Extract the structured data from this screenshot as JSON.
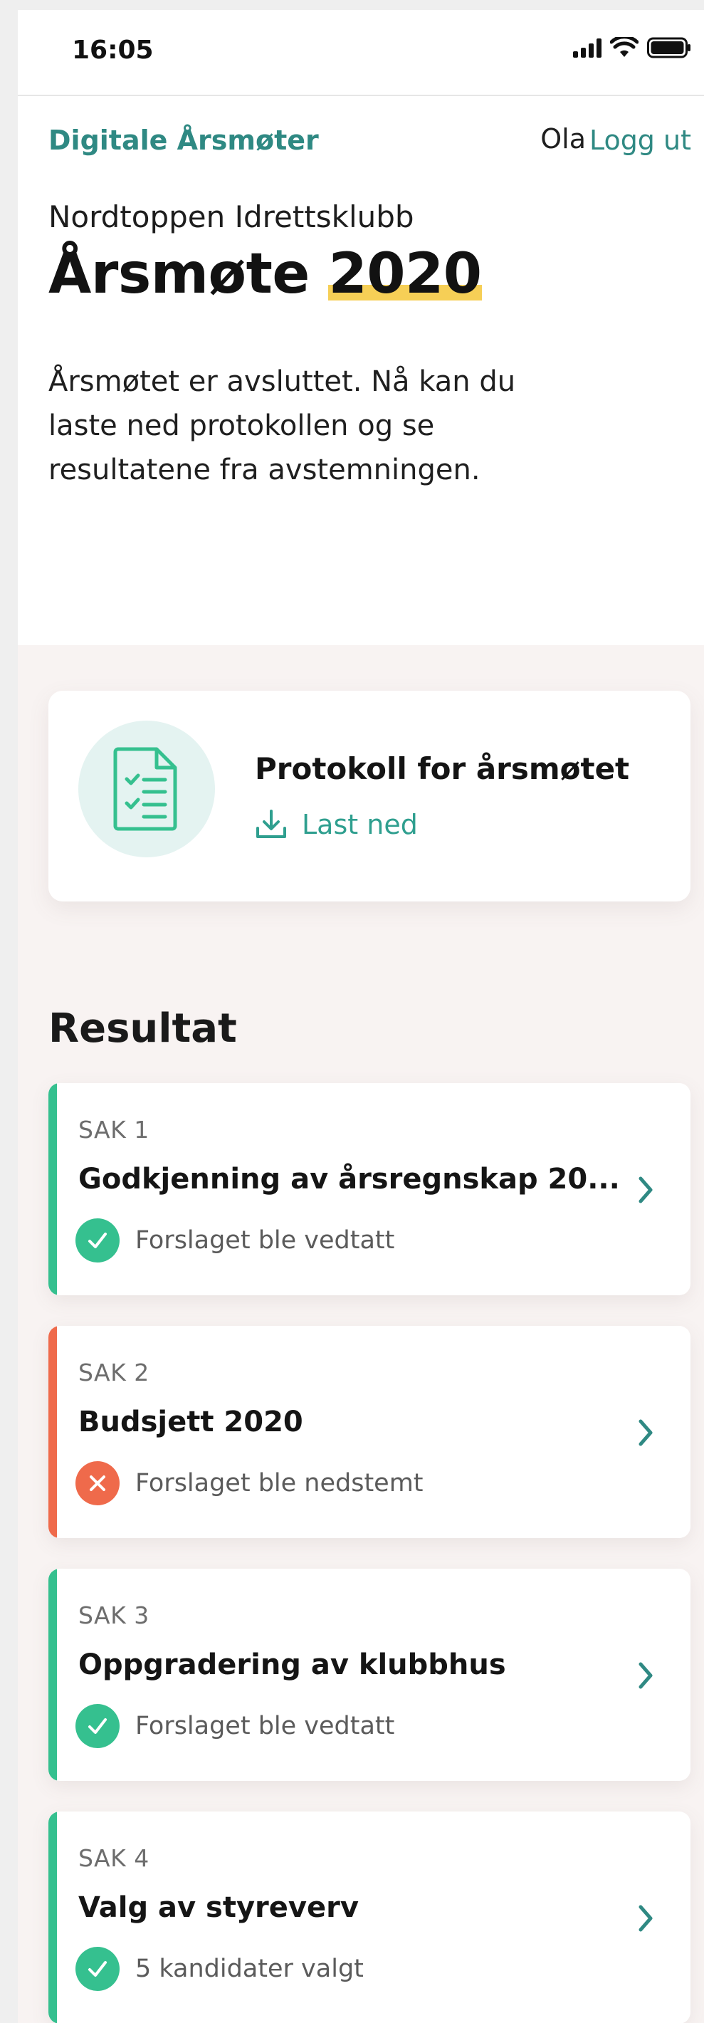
{
  "status_bar": {
    "time": "16:05"
  },
  "header": {
    "brand": "Digitale Årsmøter",
    "user": "Ola",
    "logout": "Logg ut"
  },
  "hero": {
    "organization": "Nordtoppen Idrettsklubb",
    "title_prefix": "Årsmøte",
    "title_year": "2020",
    "intro": "Årsmøtet er avsluttet. Nå kan du laste ned protokollen og se resultatene fra avstemningen."
  },
  "protocol": {
    "title": "Protokoll for årsmøtet",
    "download_label": "Last ned",
    "icon": "document-checklist-icon"
  },
  "results": {
    "heading": "Resultat",
    "cases": [
      {
        "label": "SAK 1",
        "title": "Godkjenning av årsregnskap 20...",
        "status": "Forslaget ble vedtatt",
        "outcome": "approved",
        "color": "#35c08f"
      },
      {
        "label": "SAK 2",
        "title": "Budsjett 2020",
        "status": "Forslaget ble nedstemt",
        "outcome": "rejected",
        "color": "#ef6a4b"
      },
      {
        "label": "SAK 3",
        "title": "Oppgradering av klubbhus",
        "status": "Forslaget ble vedtatt",
        "outcome": "approved",
        "color": "#35c08f"
      },
      {
        "label": "SAK 4",
        "title": "Valg av styreverv",
        "status": "5 kandidater valgt",
        "outcome": "approved",
        "color": "#35c08f"
      }
    ]
  },
  "colors": {
    "brand": "#2f8983",
    "approved": "#35c08f",
    "rejected": "#ef6a4b",
    "highlight": "#f6cf56"
  }
}
